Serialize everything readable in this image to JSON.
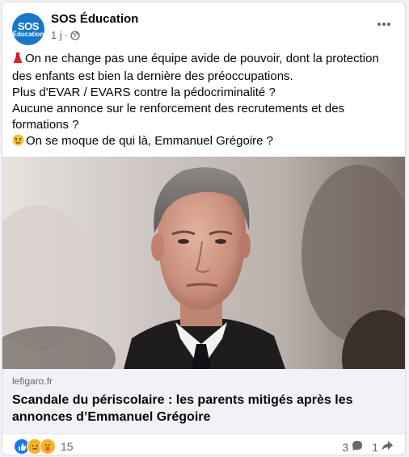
{
  "post": {
    "page_name": "SOS Éducation",
    "avatar_line1": "SOS",
    "avatar_line2": "Éducation",
    "time": "1 j",
    "separator": "·",
    "privacy_icon": "globe-icon",
    "more_icon": "more-options-icon",
    "text_lines": [
      "On ne change pas une équipe avide de pouvoir, dont la protection",
      "des enfants est bien la dernière des préoccupations.",
      "Plus d'EVAR / EVARS contre la pédocriminalité ?",
      "Aucune annonce sur le renforcement des recrutements et des",
      "formations ?",
      "On se moque de qui là, Emmanuel Grégoire ?"
    ],
    "line1_emoji": "red-dress-icon",
    "line6_emoji": "angry-face-icon"
  },
  "link_preview": {
    "domain": "lefigaro.fr",
    "headline": "Scandale du périscolaire : les parents mitigés après les annonces d’Emmanuel Grégoire"
  },
  "footer": {
    "reaction_icons": [
      "like-icon",
      "sad-icon",
      "care-icon"
    ],
    "reaction_count": "15",
    "comment_count": "3",
    "comment_icon": "comment-icon",
    "share_count": "1",
    "share_icon": "share-icon"
  },
  "colors": {
    "brand_blue": "#1877f2",
    "avatar_blue": "#1877c7",
    "text_primary": "#050505",
    "text_secondary": "#65676b",
    "link_bg": "#f0f2f5",
    "sad_yellow": "#f7b125"
  }
}
